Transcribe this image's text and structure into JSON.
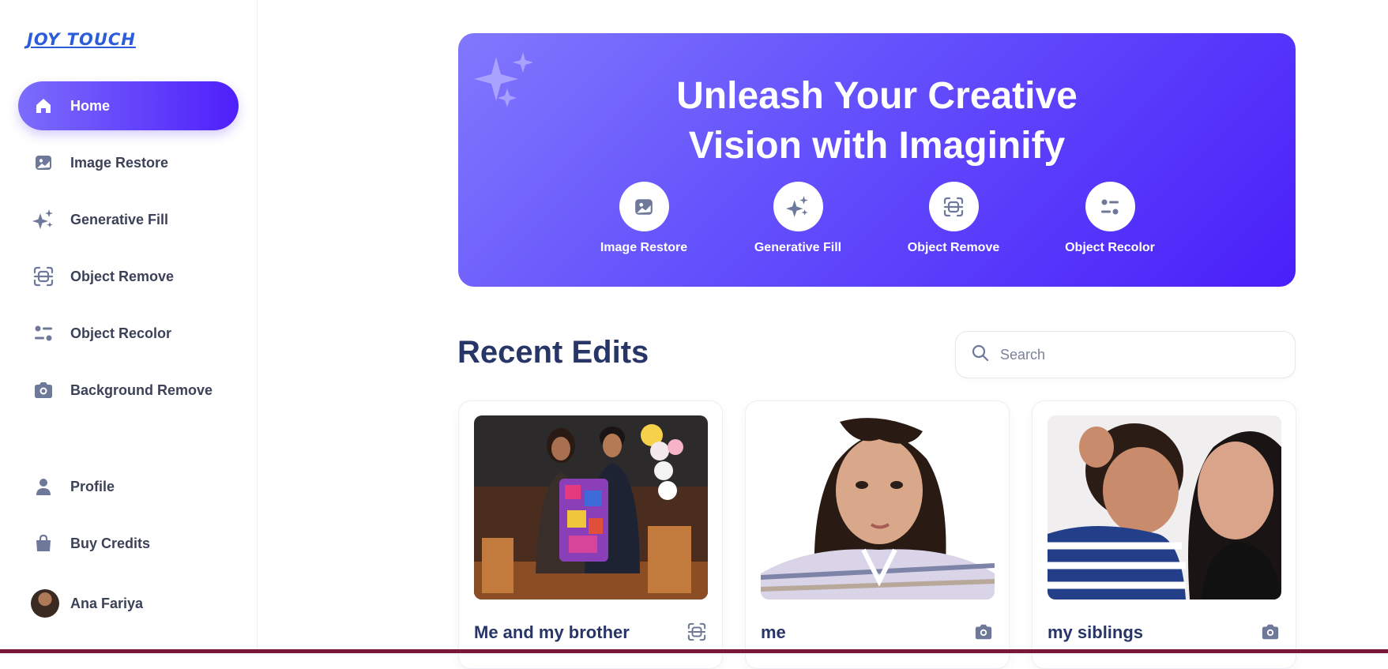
{
  "brand": {
    "logo_text": "JOY TOUCH"
  },
  "sidebar": {
    "items": [
      {
        "label": "Home",
        "icon": "home-icon",
        "active": true
      },
      {
        "label": "Image Restore",
        "icon": "image-icon"
      },
      {
        "label": "Generative Fill",
        "icon": "stars-icon"
      },
      {
        "label": "Object Remove",
        "icon": "scan-icon"
      },
      {
        "label": "Object Recolor",
        "icon": "filter-icon"
      },
      {
        "label": "Background Remove",
        "icon": "camera-icon"
      }
    ],
    "bottom": [
      {
        "label": "Profile",
        "icon": "user-icon"
      },
      {
        "label": "Buy Credits",
        "icon": "bag-icon"
      }
    ],
    "user": {
      "name": "Ana Fariya"
    }
  },
  "hero": {
    "title_line1": "Unleash Your Creative",
    "title_line2": "Vision with Imaginify",
    "tools": [
      {
        "label": "Image Restore",
        "icon": "image-icon"
      },
      {
        "label": "Generative Fill",
        "icon": "stars-icon"
      },
      {
        "label": "Object Remove",
        "icon": "scan-icon"
      },
      {
        "label": "Object Recolor",
        "icon": "filter-icon"
      }
    ]
  },
  "recent": {
    "title": "Recent Edits",
    "search_placeholder": "Search",
    "cards": [
      {
        "title": "Me and my brother",
        "icon": "scan-icon"
      },
      {
        "title": "me",
        "icon": "camera-icon"
      },
      {
        "title": "my siblings",
        "icon": "camera-icon"
      }
    ]
  },
  "colors": {
    "accent": "#5b3cfb",
    "heading": "#283567",
    "sidebar_text": "#3b4258"
  }
}
